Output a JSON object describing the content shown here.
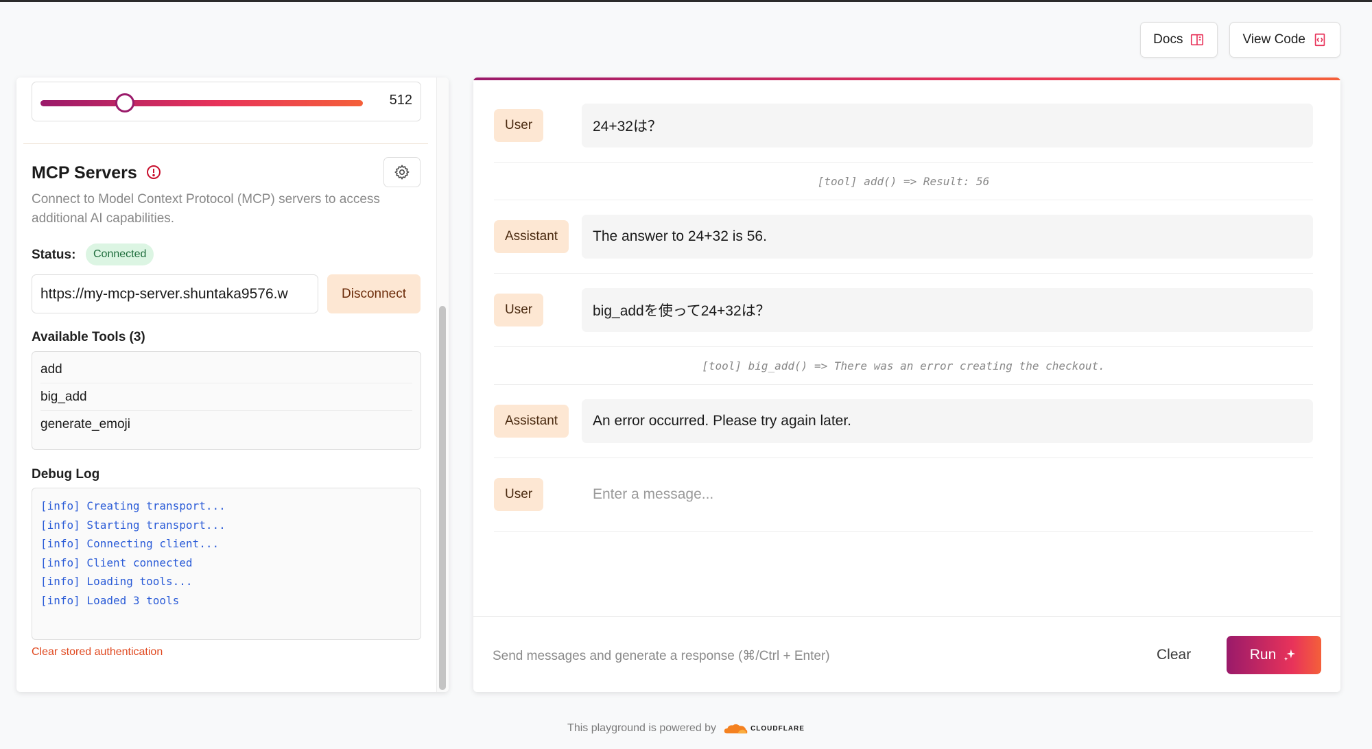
{
  "header": {
    "docs_label": "Docs",
    "view_code_label": "View Code"
  },
  "left": {
    "slider": {
      "value": "512",
      "fraction": 0.26
    },
    "mcp": {
      "title": "MCP Servers",
      "description": "Connect to Model Context Protocol (MCP) servers to access additional AI capabilities.",
      "status_label": "Status:",
      "status_value": "Connected",
      "url_value": "https://my-mcp-server.shuntaka9576.w",
      "disconnect_label": "Disconnect",
      "tools_title": "Available Tools (3)",
      "tools": [
        "add",
        "big_add",
        "generate_emoji"
      ],
      "debug_title": "Debug Log",
      "debug_log": [
        "[info] Creating transport...",
        "[info] Starting transport...",
        "[info] Connecting client...",
        "[info] Client connected",
        "[info] Loading tools...",
        "[info] Loaded 3 tools"
      ],
      "clear_auth_label": "Clear stored authentication"
    }
  },
  "chat": {
    "messages": [
      {
        "role": "User",
        "content": "24+32は？"
      },
      {
        "tool": "[tool] add() => Result: 56"
      },
      {
        "role": "Assistant",
        "content": "The answer to 24+32 is 56."
      },
      {
        "role": "User",
        "content": "big_addを使って24+32は？"
      },
      {
        "tool": "[tool] big_add() => There was an error creating the checkout."
      },
      {
        "role": "Assistant",
        "content": "An error occurred. Please try again later."
      }
    ],
    "input_role": "User",
    "input_placeholder": "Enter a message...",
    "footer_hint": "Send messages and generate a response (⌘/Ctrl + Enter)",
    "clear_label": "Clear",
    "run_label": "Run"
  },
  "footer": {
    "powered_by": "This playground is powered by",
    "brand": "CLOUDFLARE"
  },
  "colors": {
    "accent_start": "#9a1a6a",
    "accent_mid": "#e8335a",
    "accent_end": "#f4603a",
    "pill_bg": "#fde7d3",
    "status_bg": "#dcf5e3",
    "log_text": "#2a5bd7",
    "danger_text": "#e0481f"
  },
  "icons": {
    "docs": "book-icon",
    "view_code": "code-file-icon",
    "mcp_alert": "alert-circle-icon",
    "settings": "gear-icon",
    "run": "sparkle-icon",
    "brand": "cloudflare-logo"
  }
}
